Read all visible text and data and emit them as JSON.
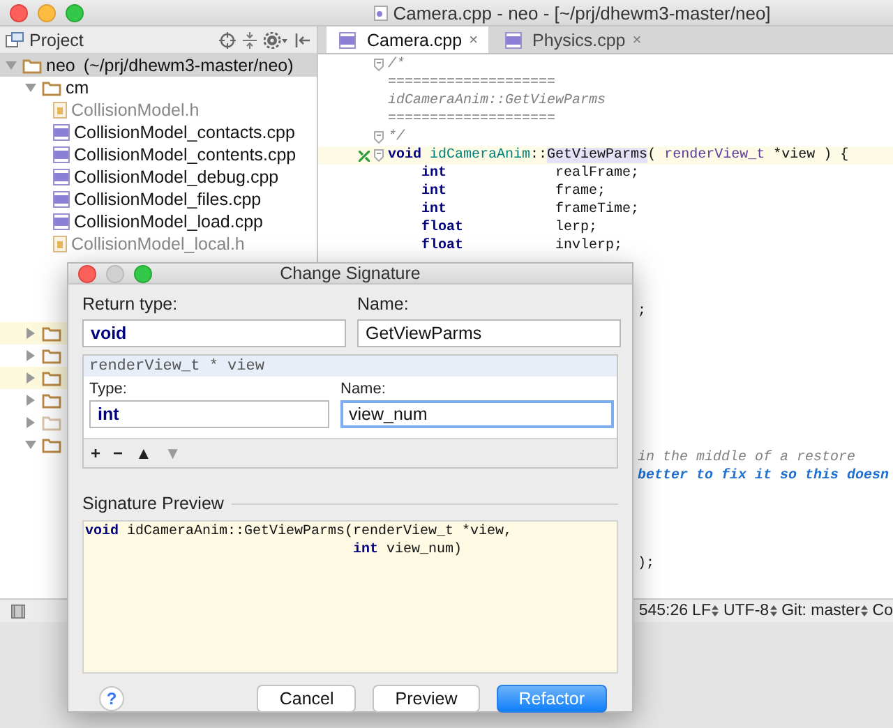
{
  "window": {
    "title": "Camera.cpp - neo - [~/prj/dhewm3-master/neo]"
  },
  "project_panel": {
    "title": "Project",
    "tree": [
      {
        "label": "neo",
        "path": "(~/prj/dhewm3-master/neo)",
        "expanded": true,
        "selected": true,
        "dimmed": false,
        "children": [
          {
            "label": "cm",
            "expanded": true,
            "selected": false,
            "highlighted": false,
            "dimmed": false,
            "children": [
              {
                "label": "CollisionModel.h",
                "kind": "header"
              },
              {
                "label": "CollisionModel_contacts.cpp",
                "kind": "source"
              },
              {
                "label": "CollisionModel_contents.cpp",
                "kind": "source"
              },
              {
                "label": "CollisionModel_debug.cpp",
                "kind": "source"
              },
              {
                "label": "CollisionModel_files.cpp",
                "kind": "source"
              },
              {
                "label": "CollisionModel_load.cpp",
                "kind": "source"
              },
              {
                "label": "CollisionModel_local.h",
                "kind": "header"
              }
            ]
          },
          {
            "expanded": false,
            "selected": false,
            "highlighted": true,
            "dimmed": false
          },
          {
            "expanded": false,
            "selected": false,
            "highlighted": false,
            "dimmed": false
          },
          {
            "expanded": false,
            "selected": false,
            "highlighted": true,
            "dimmed": false
          },
          {
            "expanded": false,
            "selected": false,
            "highlighted": false,
            "dimmed": false
          },
          {
            "expanded": false,
            "selected": false,
            "highlighted": false,
            "dimmed": true
          },
          {
            "expanded": true,
            "selected": false,
            "highlighted": false,
            "dimmed": false
          }
        ]
      }
    ]
  },
  "tabs": [
    {
      "label": "Camera.cpp",
      "selected": true,
      "close": "×"
    },
    {
      "label": "Physics.cpp",
      "selected": false,
      "close": "×"
    }
  ],
  "code_lines": [
    {
      "kind": "decl",
      "fold": true,
      "current": false,
      "segments": [
        {
          "kind": "comment",
          "text": "/*"
        }
      ]
    },
    {
      "kind": "decl",
      "fold": false,
      "current": false,
      "segments": [
        {
          "kind": "comment",
          "text": "===================="
        }
      ]
    },
    {
      "kind": "decl",
      "fold": false,
      "current": false,
      "segments": [
        {
          "kind": "comment",
          "text": "idCameraAnim::GetViewParms"
        }
      ]
    },
    {
      "kind": "decl",
      "fold": false,
      "current": false,
      "segments": [
        {
          "kind": "comment",
          "text": "===================="
        }
      ]
    },
    {
      "kind": "decl",
      "fold": true,
      "current": false,
      "segments": [
        {
          "kind": "comment",
          "text": "*/"
        }
      ]
    },
    {
      "kind": "decl",
      "fold": true,
      "current": true,
      "override": true,
      "segments": [
        {
          "kind": "keyword",
          "text": "void"
        },
        {
          "kind": "function",
          "text": " idCameraAnim"
        },
        {
          "kind": "plain",
          "text": "::"
        },
        {
          "kind": "highlight",
          "text": "GetViewParms"
        },
        {
          "kind": "plain",
          "text": "( "
        },
        {
          "kind": "type",
          "text": "renderView_t"
        },
        {
          "kind": "plain",
          "text": " *view ) {"
        }
      ]
    },
    {
      "kind": "body",
      "fold": false,
      "current": false,
      "segments": [
        {
          "kind": "keyword",
          "text": "int"
        },
        {
          "kind": "plain",
          "text": "             realFrame;"
        }
      ]
    },
    {
      "kind": "body",
      "fold": false,
      "current": false,
      "segments": [
        {
          "kind": "keyword",
          "text": "int"
        },
        {
          "kind": "plain",
          "text": "             frame;"
        }
      ]
    },
    {
      "kind": "body",
      "fold": false,
      "current": false,
      "segments": [
        {
          "kind": "keyword",
          "text": "int"
        },
        {
          "kind": "plain",
          "text": "             frameTime;"
        }
      ]
    },
    {
      "kind": "body",
      "fold": false,
      "current": false,
      "segments": [
        {
          "kind": "keyword",
          "text": "float"
        },
        {
          "kind": "plain",
          "text": "           lerp;"
        }
      ]
    },
    {
      "kind": "body",
      "fold": false,
      "current": false,
      "segments": [
        {
          "kind": "keyword",
          "text": "float"
        },
        {
          "kind": "plain",
          "text": "           invlerp;"
        }
      ]
    }
  ],
  "code_fragments": [
    {
      "kind": "plain",
      "text": ";"
    },
    {
      "kind": "comment",
      "text": "in the middle of a restore"
    },
    {
      "kind": "doc",
      "text": "better to fix it so this doesn"
    },
    {
      "kind": "plain",
      "text": ");"
    }
  ],
  "status_bar": {
    "items": [
      {
        "text": "545:26",
        "chooser": false
      },
      {
        "text": "LF",
        "chooser": true
      },
      {
        "text": "UTF-8",
        "chooser": true
      },
      {
        "text": "Git: master",
        "chooser": true
      },
      {
        "text": "Co",
        "chooser": false
      }
    ]
  },
  "dialog": {
    "title": "Change Signature",
    "return_type": {
      "label": "Return type:",
      "value": "void"
    },
    "name": {
      "label": "Name:",
      "value": "GetViewParms"
    },
    "parameter": {
      "header": "renderView_t * view",
      "type_label": "Type:",
      "type_value": "int",
      "name_label": "Name:",
      "name_value": "view_num",
      "focused": true
    },
    "toolbar": [
      {
        "symbol": "+",
        "disabled": false
      },
      {
        "symbol": "−",
        "disabled": false
      },
      {
        "symbol": "▲",
        "disabled": false
      },
      {
        "symbol": "▼",
        "disabled": true
      }
    ],
    "preview": {
      "label": "Signature Preview",
      "lines": [
        "**void** idCameraAnim::GetViewParms(renderView_t *view,",
        "                                **int** view_num)"
      ]
    },
    "help": "?",
    "buttons": [
      {
        "label": "Cancel",
        "primary": false
      },
      {
        "label": "Preview",
        "primary": false
      },
      {
        "label": "Refactor",
        "primary": true
      }
    ]
  }
}
